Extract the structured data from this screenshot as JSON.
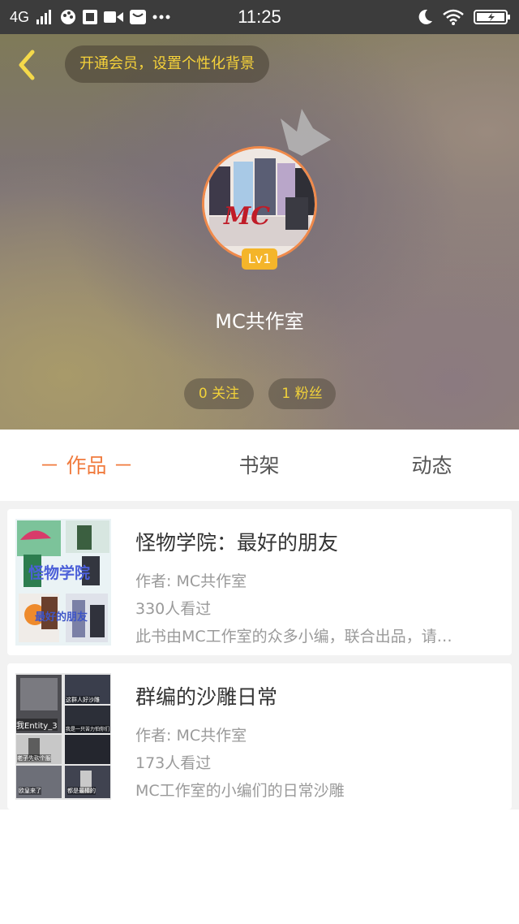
{
  "status_bar": {
    "network": "4G",
    "time": "11:25"
  },
  "header": {
    "vip_prompt": "开通会员，设置个性化背景",
    "level_badge": "Lv1",
    "username": "MC共作室",
    "avatar_text": "MC",
    "follow_label": "0 关注",
    "fans_label": "1 粉丝"
  },
  "tabs": [
    {
      "label": "－ 作品 －",
      "active": true
    },
    {
      "label": "书架",
      "active": false
    },
    {
      "label": "动态",
      "active": false
    }
  ],
  "books": [
    {
      "title": "怪物学院：最好的朋友",
      "author": "作者: MC共作室",
      "views": "330人看过",
      "description": "此书由MC工作室的众多小编，联合出品，请…",
      "cover_text_top": "怪物学院",
      "cover_text_bottom": "最好的朋友"
    },
    {
      "title": "群编的沙雕日常",
      "author": "作者: MC共作室",
      "views": "173人看过",
      "description": "MC工作室的小编们的日常沙雕",
      "cover_text_a": "我Entity_3",
      "cover_text_b": "老子先砍个服",
      "cover_text_c": "这群人好沙雕",
      "cover_text_d": "我是一只苦力怕你们",
      "cover_text_e": "欧皇来了",
      "cover_text_f": "都是最棒的"
    }
  ],
  "colors": {
    "accent": "#f07b3e",
    "gold": "#f2d23a",
    "status_bar": "#3c3c3c"
  }
}
